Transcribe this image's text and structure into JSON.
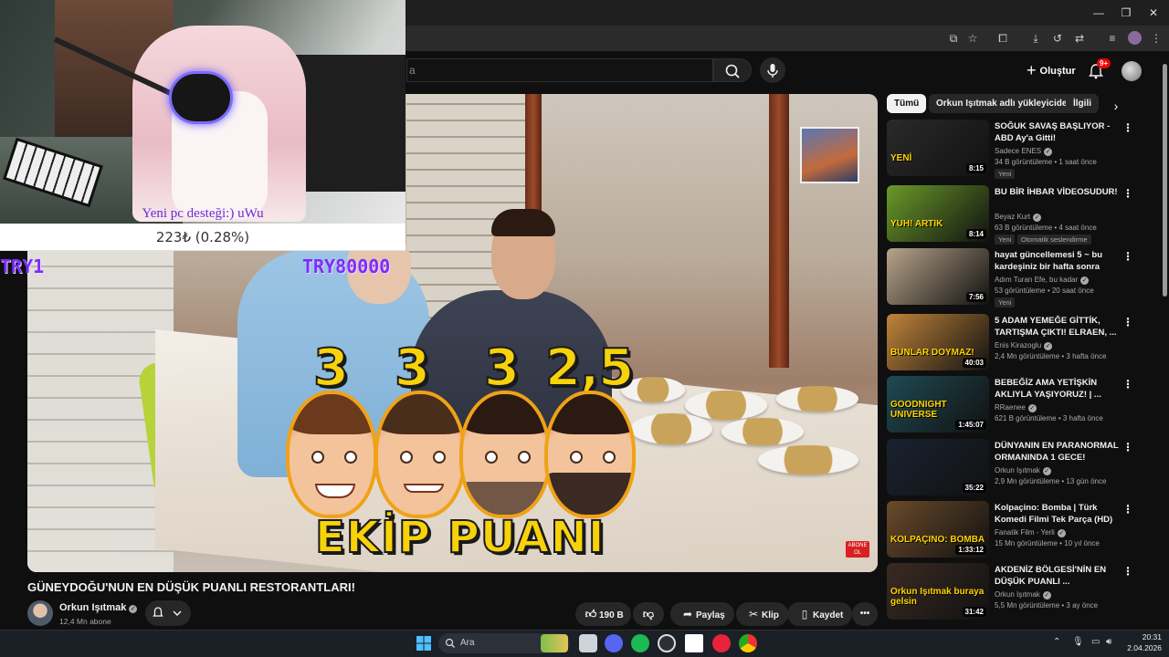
{
  "window": {
    "minimize_icon": "minimize-icon",
    "maximize_icon": "maximize-icon",
    "close_icon": "close-icon"
  },
  "header": {
    "search_placeholder": "a",
    "create_label": "Oluştur",
    "notification_badge": "9+"
  },
  "overlay": {
    "donation_text": "Yeni pc desteği:) uWu",
    "donation_amount": "223₺ (0.28%)",
    "goal_left": "TRY1",
    "goal_right": "TRY80000"
  },
  "video": {
    "scores": [
      "3",
      "3",
      "3",
      "2,5"
    ],
    "caption": "EKİP PUANI",
    "abone_badge": "ABONE OL",
    "title": "GÜNEYDOĞU'NUN EN DÜŞÜK PUANLI RESTORANTLARI!",
    "channel": "Orkun Işıtmak",
    "subscribers": "12,4 Mn abone",
    "likes": "190 B",
    "share": "Paylaş",
    "clip": "Klip",
    "save": "Kaydet"
  },
  "sidebar": {
    "chips": [
      "Tümü",
      "Orkun Işıtmak adlı yükleyiciden",
      "İlgili"
    ],
    "items": [
      {
        "title": "SOĞUK SAVAŞ BAŞLIYOR - ABD Ay'a Gitti!",
        "channel": "Sadece ENES",
        "meta": "34 B görüntüleme • 1 saat önce",
        "duration": "8:15",
        "new": "Yeni",
        "thumb": "#2a2a2a",
        "thumb_text": "YENİ"
      },
      {
        "title": "BU BİR İHBAR VİDEOSUDUR!",
        "channel": "Beyaz Kurt",
        "meta": "63 B görüntüleme • 4 saat önce",
        "duration": "8:14",
        "new": "Yeni",
        "dubbed": "Otomatik seslendirme",
        "thumb": "#6a9a2a",
        "thumb_text": "YUH! ARTIK"
      },
      {
        "title": "hayat güncellemesi 5 ~ bu kardeşiniz bir hafta sonra hap...",
        "channel": "Adım Turan Efe, bu kadar",
        "meta": "53 görüntüleme • 20 saat önce",
        "duration": "7:56",
        "new": "Yeni",
        "thumb": "#b7a48a",
        "thumb_text": ""
      },
      {
        "title": "5 ADAM YEMEĞE GİTTİK, TARTIŞMA ÇIKTI! ELRAEN, ...",
        "channel": "Enis Kirazoglu",
        "meta": "2,4 Mn görüntüleme • 3 hafta önce",
        "duration": "40:03",
        "thumb": "#c0843a",
        "thumb_text": "BUNLAR DOYMAZ!"
      },
      {
        "title": "BEBEĞİZ AMA YETİŞKİN AKLIYLA YAŞIYORUZ! | ...",
        "channel": "RRaenee",
        "meta": "621 B görüntüleme • 3 hafta önce",
        "duration": "1:45:07",
        "thumb": "#1f4a52",
        "thumb_text": "GOODNIGHT UNIVERSE"
      },
      {
        "title": "DÜNYANIN EN PARANORMAL ORMANINDA 1 GECE!",
        "channel": "Orkun Işıtmak",
        "meta": "2,9 Mn görüntüleme • 13 gün önce",
        "duration": "35:22",
        "thumb": "#1a2230",
        "thumb_text": ""
      },
      {
        "title": "Kolpaçino: Bomba | Türk Komedi Filmi Tek Parça (HD)",
        "channel": "Fanatik Film - Yerli",
        "meta": "15 Mn görüntüleme • 10 yıl önce",
        "duration": "1:33:12",
        "thumb": "#6a4a2a",
        "thumb_text": "KOLPAÇINO: BOMBA"
      },
      {
        "title": "AKDENİZ BÖLGESİ'NİN EN DÜŞÜK PUANLI ...",
        "channel": "Orkun Işıtmak",
        "meta": "5,5 Mn görüntüleme • 3 ay önce",
        "duration": "31:42",
        "thumb": "#3a2a22",
        "thumb_text": "Orkun Işıtmak buraya gelsin"
      }
    ]
  },
  "taskbar": {
    "search_label": "Ara",
    "time": "20:31",
    "date": "2.04.2026"
  }
}
